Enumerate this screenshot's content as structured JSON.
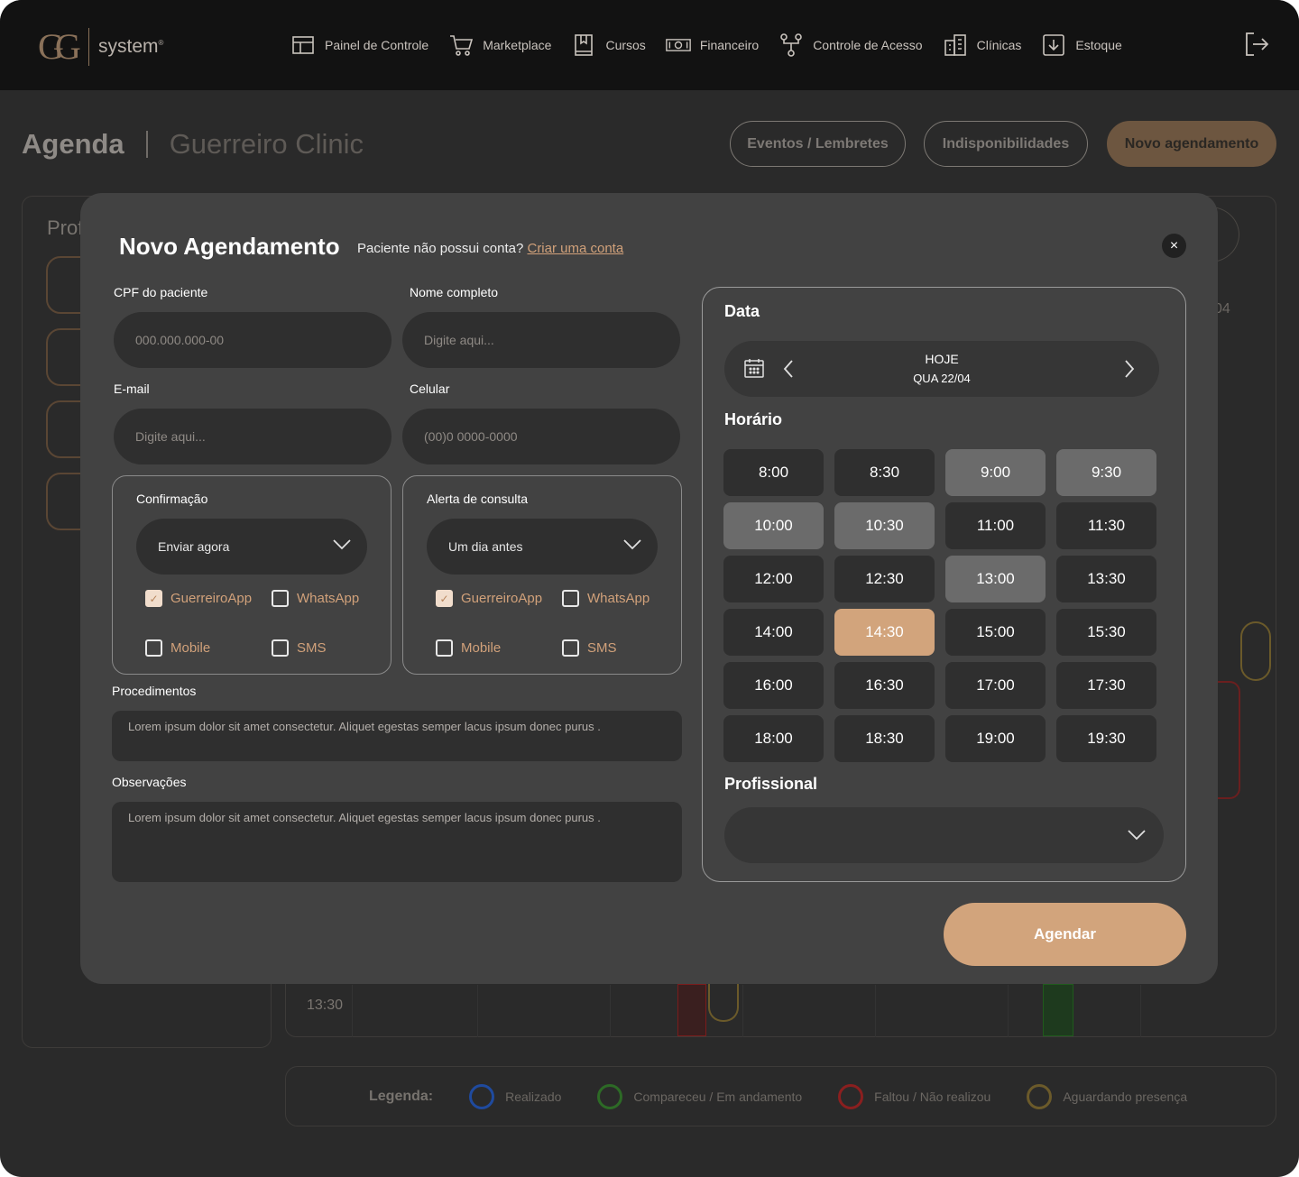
{
  "brand": {
    "logo_mark": "GG",
    "logo_text": "system",
    "logo_reg": "®"
  },
  "nav": [
    {
      "label": "Painel de Controle",
      "icon": "dashboard-icon"
    },
    {
      "label": "Marketplace",
      "icon": "cart-icon"
    },
    {
      "label": "Cursos",
      "icon": "book-icon"
    },
    {
      "label": "Financeiro",
      "icon": "money-icon"
    },
    {
      "label": "Controle de Acesso",
      "icon": "access-icon"
    },
    {
      "label": "Clínicas",
      "icon": "building-icon"
    },
    {
      "label": "Estoque",
      "icon": "download-box-icon"
    }
  ],
  "page": {
    "title": "Agenda",
    "clinic": "Guerreiro Clinic",
    "buttons": {
      "events": "Eventos / Lembretes",
      "unavailability": "Indisponibilidades",
      "new": "Novo agendamento"
    }
  },
  "background": {
    "prof_label": "Prof",
    "time": "13:30",
    "date_fragment": "04"
  },
  "legend": {
    "title": "Legenda:",
    "items": [
      {
        "label": "Realizado",
        "color": "#1f4a9e"
      },
      {
        "label": "Compareceu / Em andamento",
        "color": "#2d6a26"
      },
      {
        "label": "Faltou / Não realizou",
        "color": "#8a1f1f"
      },
      {
        "label": "Aguardando presença",
        "color": "#6b5a2a"
      }
    ]
  },
  "modal": {
    "title": "Novo Agendamento",
    "subtitle": "Paciente não possui conta?",
    "create_link": "Criar uma conta",
    "close": "×",
    "fields": {
      "cpf": {
        "label": "CPF do paciente",
        "placeholder": "000.000.000-00"
      },
      "name": {
        "label": "Nome completo",
        "placeholder": "Digite aqui..."
      },
      "email": {
        "label": "E-mail",
        "placeholder": "Digite aqui..."
      },
      "phone": {
        "label": "Celular",
        "placeholder": "(00)0 0000-0000"
      }
    },
    "confirmation": {
      "title": "Confirmação",
      "selected": "Enviar agora",
      "options": [
        {
          "label": "GuerreiroApp",
          "checked": true
        },
        {
          "label": "WhatsApp",
          "checked": false
        },
        {
          "label": "Mobile",
          "checked": false
        },
        {
          "label": "SMS",
          "checked": false
        }
      ]
    },
    "alert": {
      "title": "Alerta de consulta",
      "selected": "Um dia antes",
      "options": [
        {
          "label": "GuerreiroApp",
          "checked": true
        },
        {
          "label": "WhatsApp",
          "checked": false
        },
        {
          "label": "Mobile",
          "checked": false
        },
        {
          "label": "SMS",
          "checked": false
        }
      ]
    },
    "procedures": {
      "label": "Procedimentos",
      "value": "Lorem ipsum dolor sit amet consectetur. Aliquet egestas semper lacus ipsum donec purus ."
    },
    "notes": {
      "label": "Observações",
      "value": "Lorem ipsum dolor sit amet consectetur. Aliquet egestas semper lacus ipsum donec purus ."
    },
    "date": {
      "label": "Data",
      "today": "HOJE",
      "date": "QUA 22/04"
    },
    "time": {
      "label": "Horário",
      "slots": [
        {
          "t": "8:00",
          "s": "free"
        },
        {
          "t": "8:30",
          "s": "free"
        },
        {
          "t": "9:00",
          "s": "busy"
        },
        {
          "t": "9:30",
          "s": "busy"
        },
        {
          "t": "10:00",
          "s": "busy"
        },
        {
          "t": "10:30",
          "s": "busy"
        },
        {
          "t": "11:00",
          "s": "free"
        },
        {
          "t": "11:30",
          "s": "free"
        },
        {
          "t": "12:00",
          "s": "free"
        },
        {
          "t": "12:30",
          "s": "free"
        },
        {
          "t": "13:00",
          "s": "busy"
        },
        {
          "t": "13:30",
          "s": "free"
        },
        {
          "t": "14:00",
          "s": "free"
        },
        {
          "t": "14:30",
          "s": "selected"
        },
        {
          "t": "15:00",
          "s": "free"
        },
        {
          "t": "15:30",
          "s": "free"
        },
        {
          "t": "16:00",
          "s": "free"
        },
        {
          "t": "16:30",
          "s": "free"
        },
        {
          "t": "17:00",
          "s": "free"
        },
        {
          "t": "17:30",
          "s": "free"
        },
        {
          "t": "18:00",
          "s": "free"
        },
        {
          "t": "18:30",
          "s": "free"
        },
        {
          "t": "19:00",
          "s": "free"
        },
        {
          "t": "19:30",
          "s": "free"
        }
      ]
    },
    "professional": {
      "label": "Profissional",
      "value": ""
    },
    "submit": "Agendar"
  },
  "colors": {
    "accent": "#d2a47c",
    "modal_bg": "#424242",
    "field_bg": "#2f2f2f",
    "busy_slot": "#6b6b6b"
  }
}
